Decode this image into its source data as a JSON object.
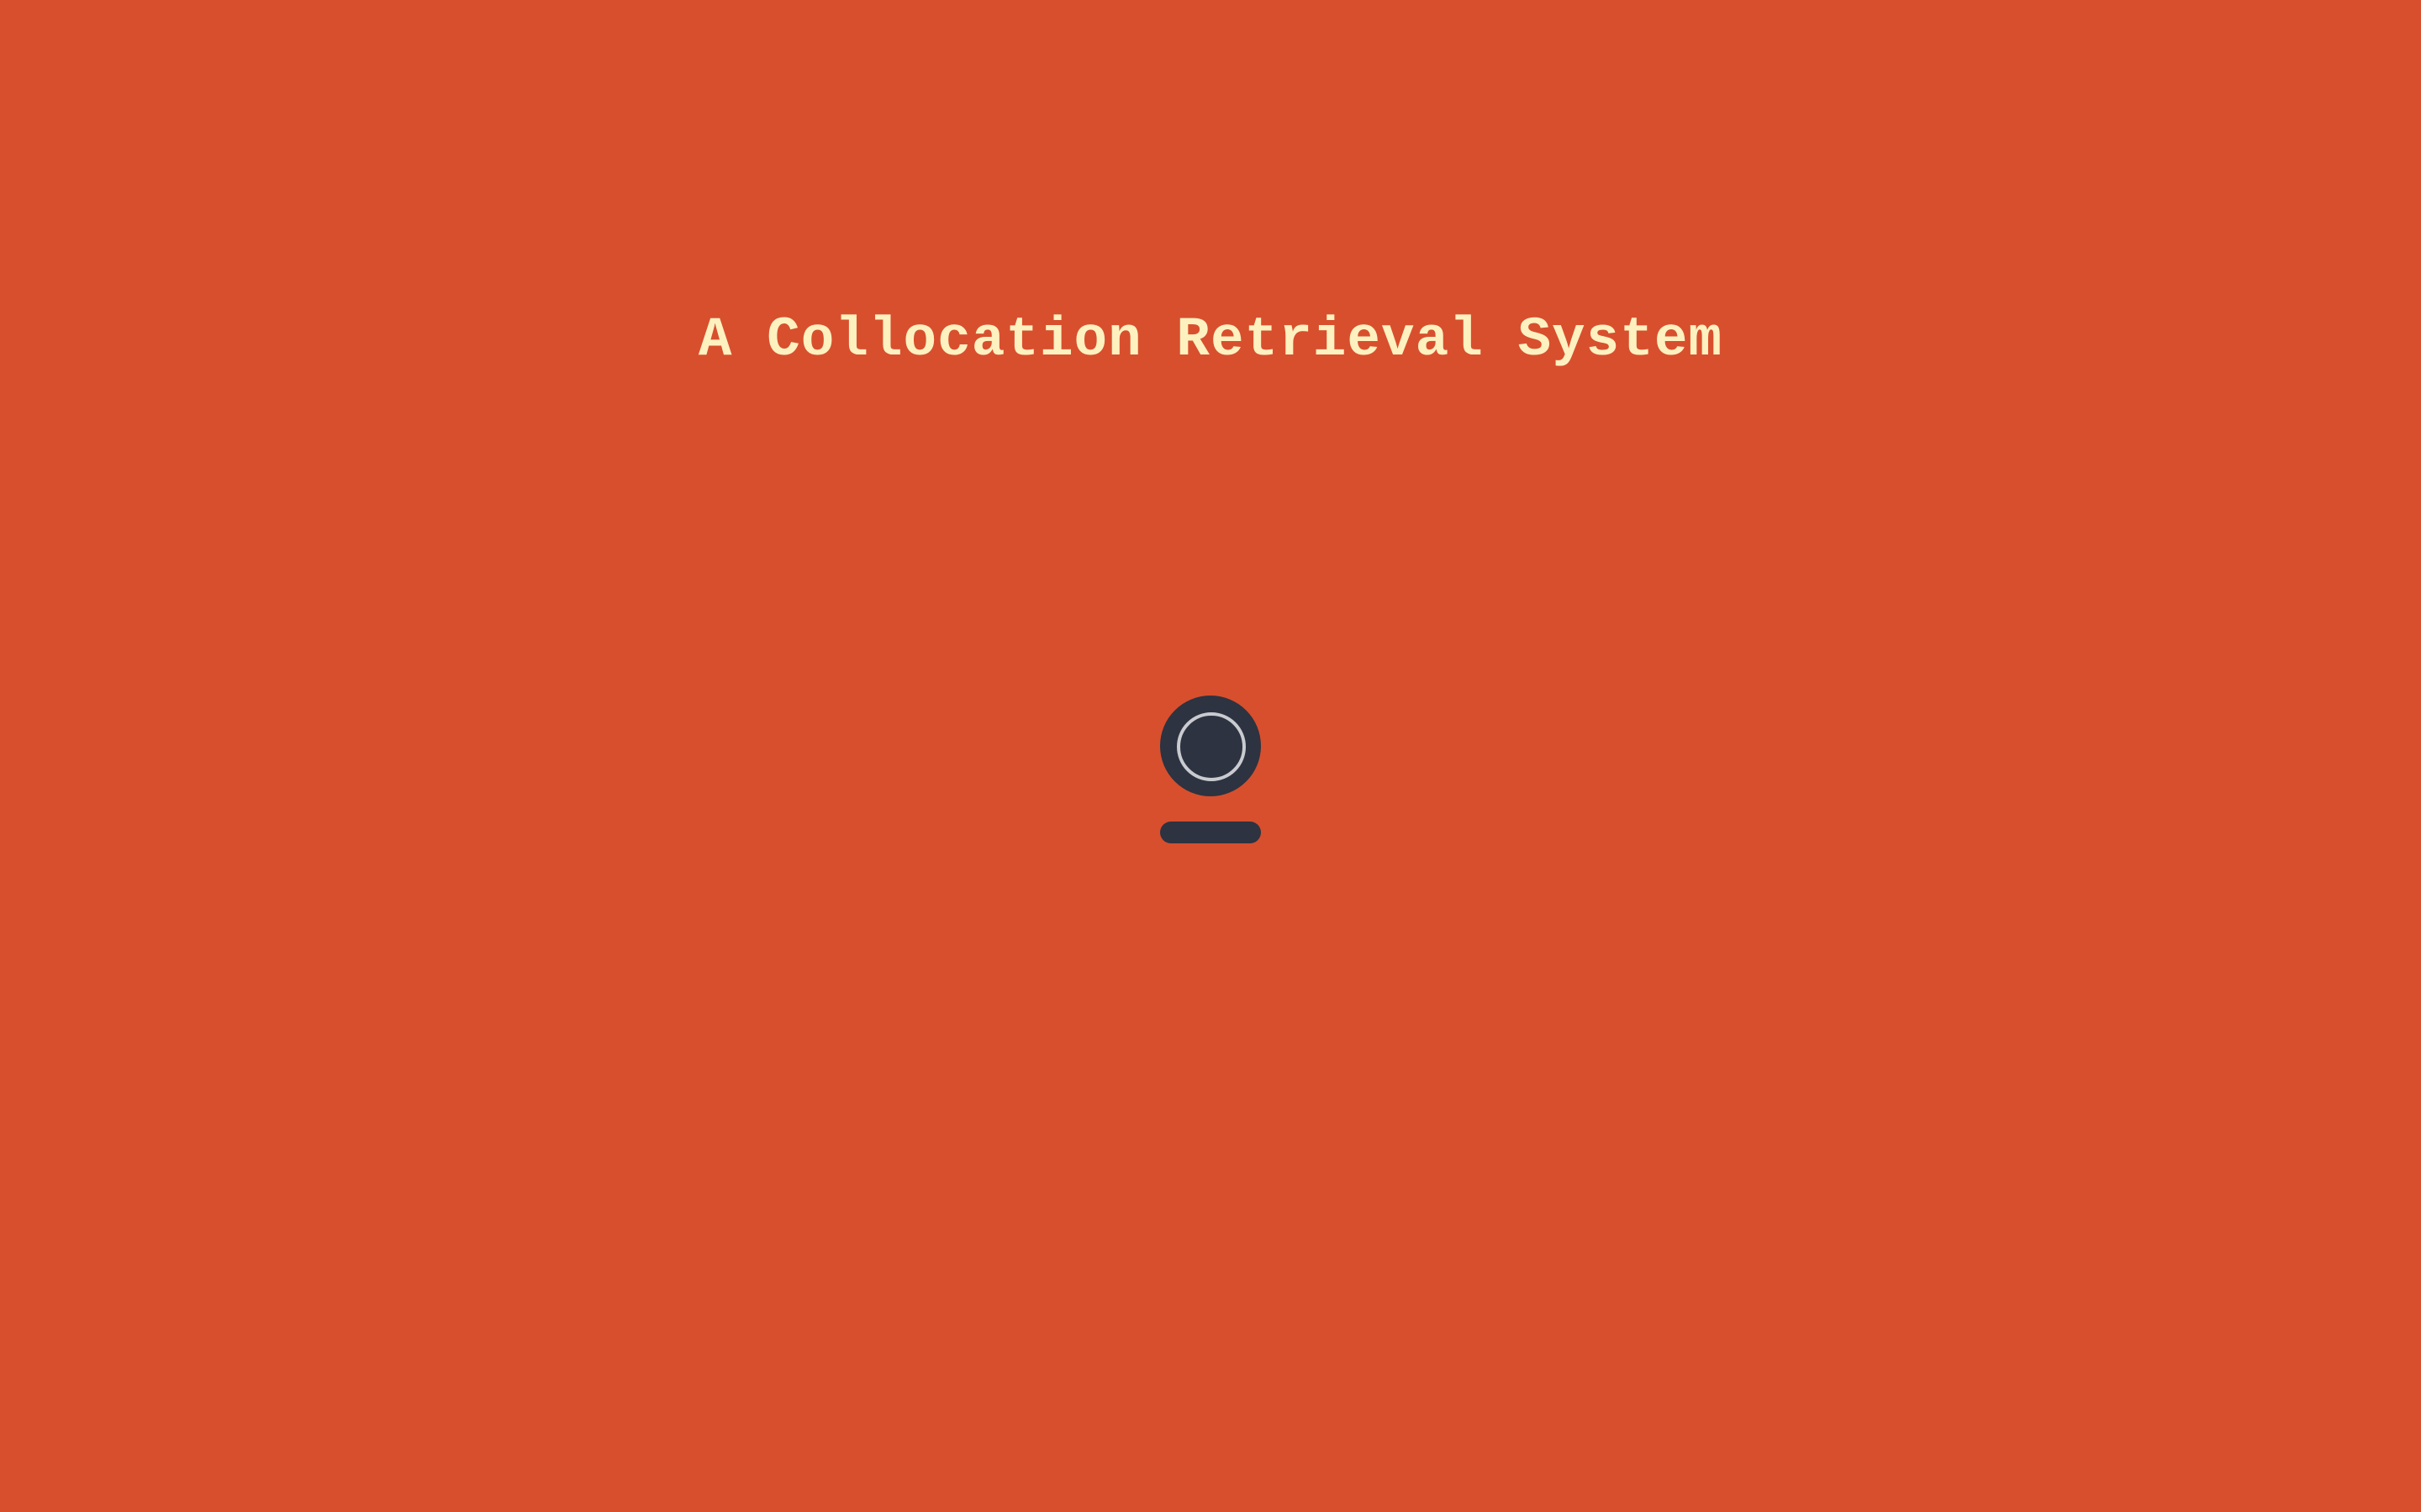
{
  "page": {
    "title": "A Collocation Retrieval System",
    "background_color": "#d84f2e",
    "title_color": "#fdf1c0"
  },
  "logo": {
    "icon": "record-button-icon",
    "disc_color": "#2d3340",
    "ring_color": "#c9cbd0"
  }
}
